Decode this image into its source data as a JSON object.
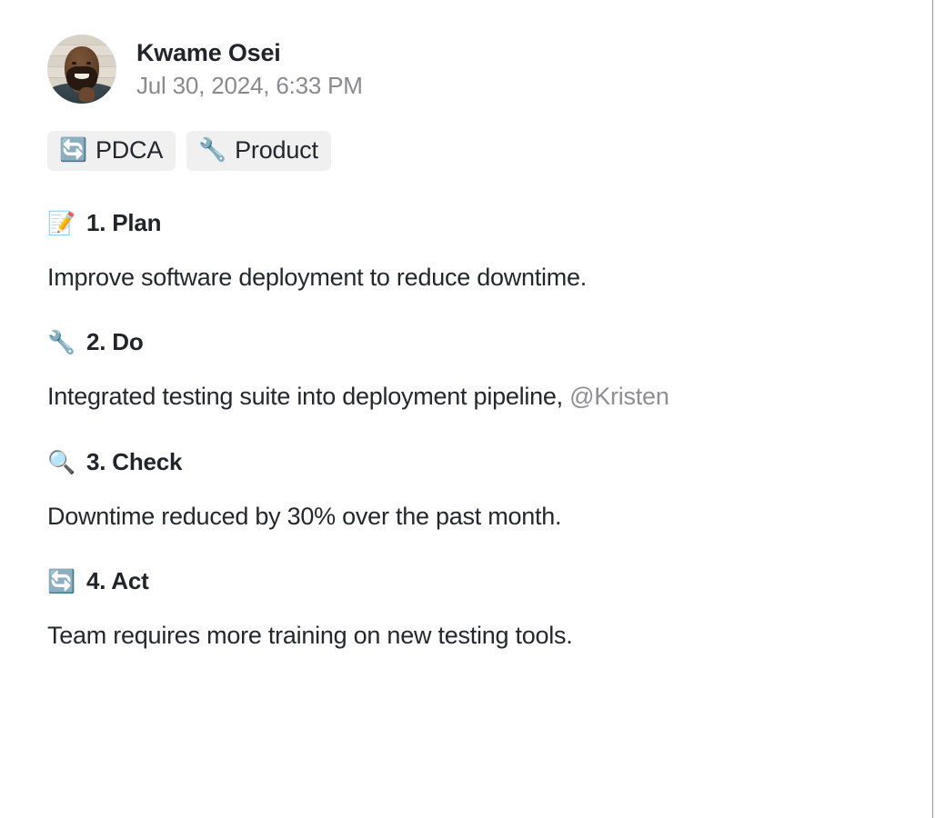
{
  "note": {
    "author": {
      "name": "Kwame Osei",
      "avatar_alt": "user-photo"
    },
    "timestamp": "Jul 30, 2024, 6:33 PM",
    "tags": [
      {
        "emoji": "🔄",
        "emoji_name": "arrows-counterclockwise-icon",
        "label": "PDCA"
      },
      {
        "emoji": "🔧",
        "emoji_name": "wrench-icon",
        "label": "Product"
      }
    ],
    "sections": [
      {
        "emoji": "📝",
        "emoji_name": "memo-icon",
        "heading": "1. Plan",
        "body_prefix": "Improve software deployment to reduce downtime.",
        "mention": "",
        "body_suffix": ""
      },
      {
        "emoji": "🔧",
        "emoji_name": "wrench-icon",
        "heading": "2. Do",
        "body_prefix": "Integrated testing suite into deployment pipeline, ",
        "mention": "@Kristen",
        "body_suffix": ""
      },
      {
        "emoji": "🔍",
        "emoji_name": "magnifying-glass-icon",
        "heading": "3. Check",
        "body_prefix": "Downtime reduced by 30% over the past month.",
        "mention": "",
        "body_suffix": ""
      },
      {
        "emoji": "🔄",
        "emoji_name": "arrows-counterclockwise-icon",
        "heading": "4. Act",
        "body_prefix": "Team requires more training on new testing tools.",
        "mention": "",
        "body_suffix": ""
      }
    ]
  },
  "colors": {
    "text_primary": "#22242a",
    "text_body": "#25272c",
    "text_muted": "#8a8a8e",
    "mention": "#8e8e93",
    "chip_bg": "#f0f0f0",
    "page_bg": "#ffffff",
    "panel_edge": "#9a9a9a"
  }
}
